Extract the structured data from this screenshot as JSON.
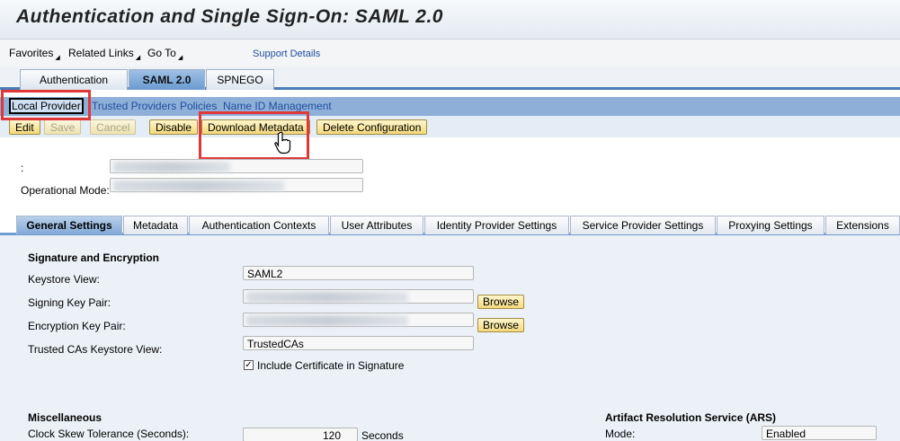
{
  "title": "Authentication and Single Sign-On: SAML 2.0",
  "menu": {
    "favorites": "Favorites",
    "related_links": "Related Links",
    "go_to": "Go To",
    "support_details": "Support Details"
  },
  "main_tabs": [
    {
      "label": "Authentication",
      "active": false
    },
    {
      "label": "SAML 2.0",
      "active": true
    },
    {
      "label": "SPNEGO",
      "active": false
    }
  ],
  "sub_nav": [
    {
      "label": "Local Provider",
      "selected": true
    },
    {
      "label": "Trusted Providers",
      "selected": false
    },
    {
      "label": "Policies",
      "selected": false
    },
    {
      "label": "Name ID Management",
      "selected": false
    }
  ],
  "toolbar": {
    "edit": "Edit",
    "save": "Save",
    "cancel": "Cancel",
    "disable": "Disable",
    "download_metadata": "Download Metadata",
    "delete_configuration": "Delete Configuration"
  },
  "provider": {
    "name_label": ":",
    "operational_mode_label": "Operational Mode:"
  },
  "detail_tabs": [
    {
      "label": "General Settings",
      "active": true
    },
    {
      "label": "Metadata",
      "active": false
    },
    {
      "label": "Authentication Contexts",
      "active": false
    },
    {
      "label": "User Attributes",
      "active": false
    },
    {
      "label": "Identity Provider Settings",
      "active": false
    },
    {
      "label": "Service Provider Settings",
      "active": false
    },
    {
      "label": "Proxying Settings",
      "active": false
    },
    {
      "label": "Extensions",
      "active": false
    }
  ],
  "signature": {
    "section_title": "Signature and Encryption",
    "keystore_view_label": "Keystore View:",
    "keystore_view_value": "SAML2",
    "signing_key_pair_label": "Signing Key Pair:",
    "encryption_key_pair_label": "Encryption Key Pair:",
    "browse": "Browse",
    "trusted_cas_label": "Trusted CAs Keystore View:",
    "trusted_cas_value": "TrustedCAs",
    "include_cert_label": "Include Certificate in Signature",
    "include_cert_checked": true
  },
  "misc": {
    "section_title": "Miscellaneous",
    "clock_skew_label": "Clock Skew Tolerance (Seconds):",
    "clock_skew_value": "120",
    "seconds_unit": "Seconds"
  },
  "ars": {
    "section_title": "Artifact Resolution Service (ARS)",
    "mode_label": "Mode:",
    "mode_value": "Enabled"
  },
  "colors": {
    "highlight": "#e03838",
    "tab_accent": "#4b7cb5",
    "button_bg": "#f3d97d"
  }
}
